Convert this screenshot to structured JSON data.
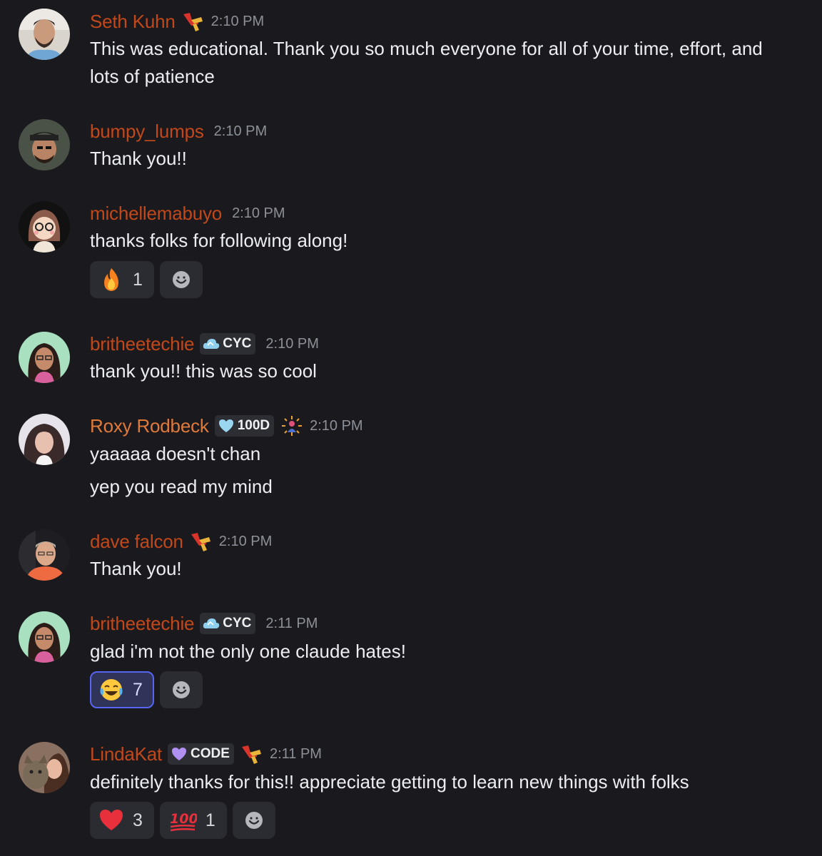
{
  "messages": [
    {
      "username": "Seth Kuhn",
      "timestamp": "2:10 PM",
      "role_icon": "red-yellow-role-icon",
      "lines": [
        "This was educational. Thank you so much everyone for all of your time, effort, and",
        "lots of patience"
      ]
    },
    {
      "username": "bumpy_lumps",
      "timestamp": "2:10 PM",
      "lines": [
        "Thank you!!"
      ]
    },
    {
      "username": "michellemabuyo",
      "timestamp": "2:10 PM",
      "lines": [
        "thanks folks for following along!"
      ],
      "reactions": [
        {
          "emoji": "fire-emoji",
          "count": "1"
        }
      ]
    },
    {
      "username": "britheetechie",
      "timestamp": "2:10 PM",
      "tag": "CYC",
      "tag_icon": "cloud-icon",
      "lines": [
        "thank you!! this was so cool"
      ]
    },
    {
      "username": "Roxy Rodbeck",
      "timestamp": "2:10 PM",
      "tag": "100D",
      "tag_icon": "heart-icon",
      "role_icon": "sparkle-person-icon",
      "lines": [
        "yaaaaa doesn't chan",
        "yep you read my mind"
      ]
    },
    {
      "username": "dave falcon",
      "timestamp": "2:10 PM",
      "role_icon": "red-yellow-role-icon",
      "lines": [
        "Thank you!"
      ]
    },
    {
      "username": "britheetechie",
      "timestamp": "2:11 PM",
      "tag": "CYC",
      "tag_icon": "cloud-icon",
      "lines": [
        "glad i'm not the only one claude hates!"
      ],
      "reactions": [
        {
          "emoji": "tears-of-joy-emoji",
          "count": "7",
          "selected": true
        }
      ]
    },
    {
      "username": "LindaKat",
      "timestamp": "2:11 PM",
      "tag": "CODE",
      "tag_icon": "purple-heart-icon",
      "role_icon": "red-yellow-role-icon",
      "lines": [
        "definitely thanks for this!! appreciate getting to learn new things with folks"
      ],
      "reactions": [
        {
          "emoji": "red-heart-emoji",
          "count": "3"
        },
        {
          "emoji": "hundred-points-emoji",
          "count": "1"
        }
      ]
    }
  ],
  "colors": {
    "background": "#1a1a1e",
    "username": "#c2481a",
    "username_alt": "#e07a3a",
    "timestamp": "#8e9098",
    "reaction_bg": "#2b2c31",
    "reaction_selected_border": "#5865f2"
  }
}
